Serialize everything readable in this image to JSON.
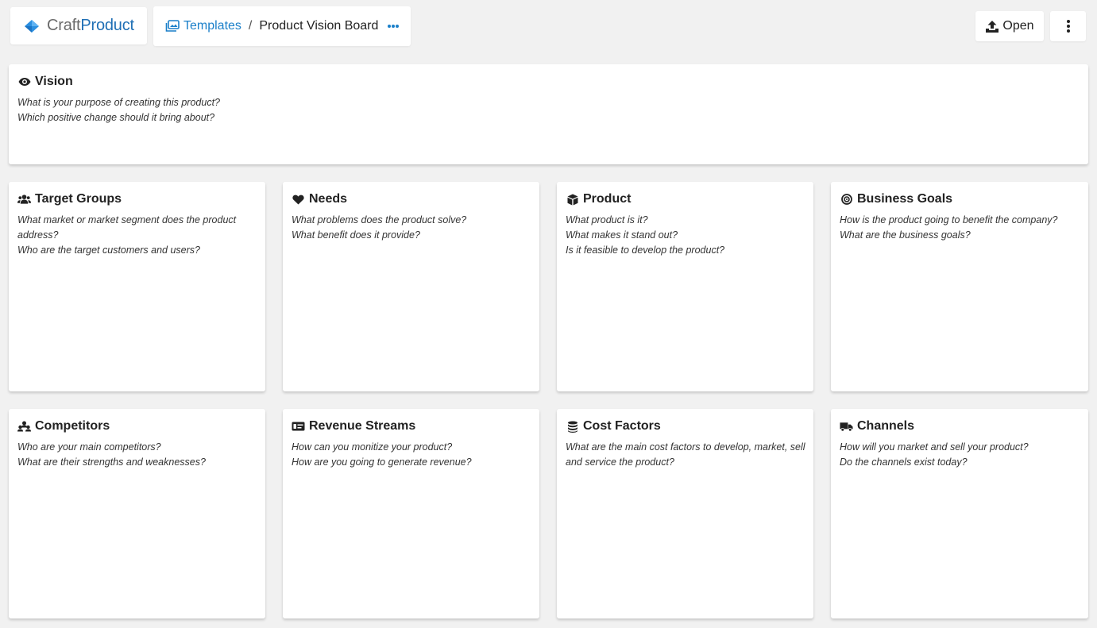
{
  "app": {
    "logo_prefix": "Craft",
    "logo_suffix": "Product"
  },
  "breadcrumb": {
    "parent": "Templates",
    "separator": "/",
    "current": "Product Vision Board"
  },
  "toolbar": {
    "open_label": "Open"
  },
  "colors": {
    "accent": "#1a7fc9",
    "background": "#f1f1f1",
    "card": "#ffffff"
  },
  "cards": [
    {
      "title": "Vision",
      "icon": "eye-icon",
      "lines": [
        "What is your purpose of creating this product?",
        "Which positive change should it bring about?"
      ]
    },
    {
      "title": "Target Groups",
      "icon": "users-icon",
      "lines": [
        "What market or market segment does the product address?",
        "Who are the target customers and users?"
      ]
    },
    {
      "title": "Needs",
      "icon": "heart-icon",
      "lines": [
        "What problems does the product solve?",
        "What benefit does it provide?"
      ]
    },
    {
      "title": "Product",
      "icon": "box-icon",
      "lines": [
        "What product is it?",
        "What makes it stand out?",
        "Is it feasible to develop the product?"
      ]
    },
    {
      "title": "Business Goals",
      "icon": "target-icon",
      "lines": [
        "How is the product going to benefit the company?",
        "What are the business goals?"
      ]
    },
    {
      "title": "Competitors",
      "icon": "competitors-icon",
      "lines": [
        "Who are your main competitors?",
        "What are their strengths and weaknesses?"
      ]
    },
    {
      "title": "Revenue Streams",
      "icon": "money-card-icon",
      "lines": [
        "How can you monitize your product?",
        "How are you going to generate revenue?"
      ]
    },
    {
      "title": "Cost Factors",
      "icon": "coins-icon",
      "lines": [
        "What are the main cost factors to develop, market, sell and service the product?"
      ]
    },
    {
      "title": "Channels",
      "icon": "truck-icon",
      "lines": [
        "How will you market and sell your product?",
        "Do the channels exist today?"
      ]
    }
  ]
}
